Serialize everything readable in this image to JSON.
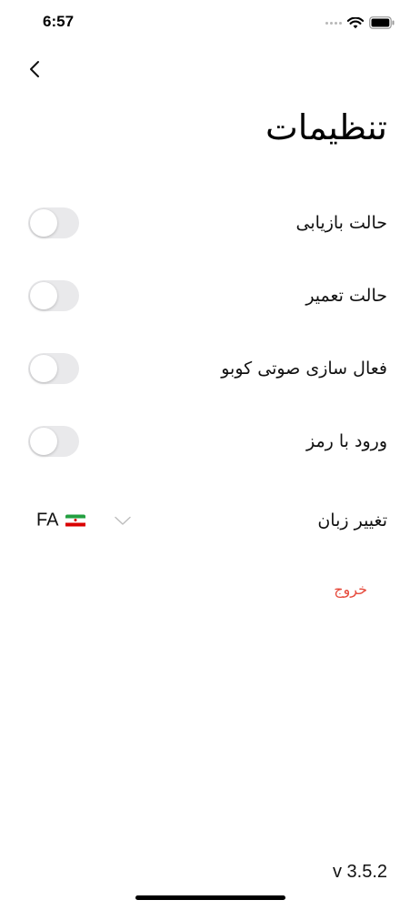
{
  "status_bar": {
    "time": "6:57",
    "icons": [
      "signal-dots-icon",
      "wifi-icon",
      "battery-icon"
    ]
  },
  "header": {
    "back_icon": "chevron-left-icon",
    "title": "تنظیمات"
  },
  "settings": {
    "items": [
      {
        "label": "حالت بازیابی",
        "enabled": false
      },
      {
        "label": "حالت تعمیر",
        "enabled": false
      },
      {
        "label": "فعال سازی صوتی کوبو",
        "enabled": false
      },
      {
        "label": "ورود با رمز",
        "enabled": false
      }
    ],
    "language": {
      "label": "تغییر زبان",
      "selected": "FA",
      "flag_icon": "iran-flag-icon",
      "dropdown_icon": "chevron-down-icon"
    }
  },
  "logout_label": "خروج",
  "version": "v 3.5.2",
  "colors": {
    "background": "#ffffff",
    "text": "#111111",
    "toggle_off": "#e9e9eb",
    "logout": "#e64a3c"
  }
}
